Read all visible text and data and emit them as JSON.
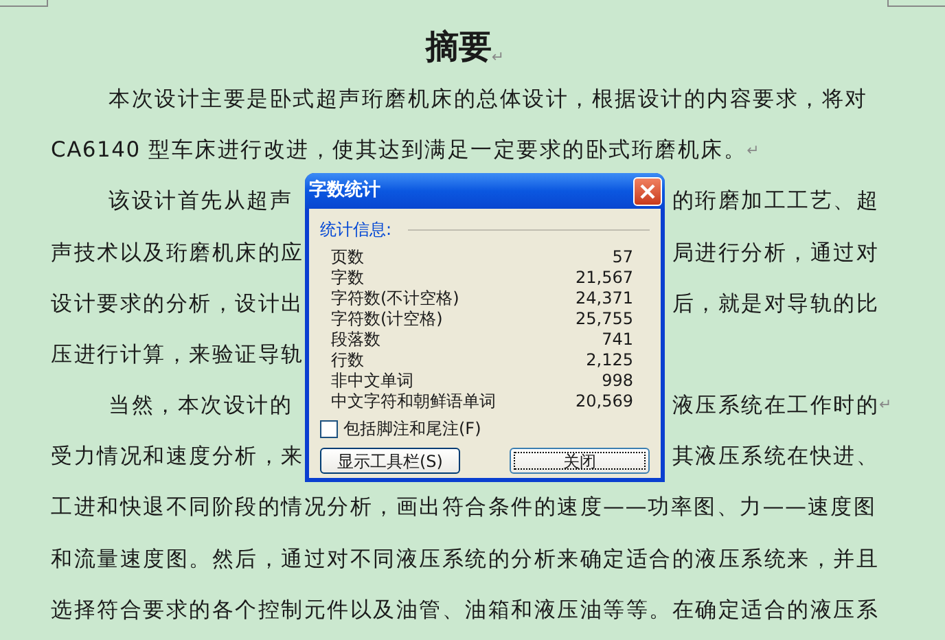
{
  "document": {
    "title": "摘要",
    "title_mark": "↵",
    "lines": [
      {
        "indent": true,
        "left": "本次设计主要是卧式超声珩磨机床的总体设计，根据设计的内容要求，将对"
      },
      {
        "indent": false,
        "left": "CA6140 型车床进行改进，使其达到满足一定要求的卧式珩磨机床。",
        "mark": "↵"
      },
      {
        "indent": true,
        "left": "该设计首先从超声",
        "right": "的珩磨加工工艺、超"
      },
      {
        "indent": false,
        "left": "声技术以及珩磨机床的应",
        "right": "局进行分析，通过对"
      },
      {
        "indent": false,
        "left": "设计要求的分析，设计出",
        "right": "后，就是对导轨的比"
      },
      {
        "indent": false,
        "left": "压进行计算，来验证导轨"
      },
      {
        "indent": true,
        "left": "当然，本次设计的",
        "right": "液压系统在工作时的",
        "mark": "↵"
      },
      {
        "indent": false,
        "left": "受力情况和速度分析，来",
        "right": "其液压系统在快进、"
      },
      {
        "indent": false,
        "left": "工进和快退不同阶段的情况分析，画出符合条件的速度——功率图、力——速度图"
      },
      {
        "indent": false,
        "left": "和流量速度图。然后，通过对不同液压系统的分析来确定适合的液压系统来，并且"
      },
      {
        "indent": false,
        "left": "选择符合要求的各个控制元件以及油管、油箱和液压油等等。在确定适合的液压系"
      }
    ]
  },
  "dialog": {
    "title": "字数统计",
    "group_label": "统计信息:",
    "stats": [
      {
        "label": "页数",
        "value": "57"
      },
      {
        "label": "字数",
        "value": "21,567"
      },
      {
        "label": "字符数(不计空格)",
        "value": "24,371"
      },
      {
        "label": "字符数(计空格)",
        "value": "25,755"
      },
      {
        "label": "段落数",
        "value": "741"
      },
      {
        "label": "行数",
        "value": "2,125"
      },
      {
        "label": "非中文单词",
        "value": "998"
      },
      {
        "label": "中文字符和朝鲜语单词",
        "value": "20,569"
      }
    ],
    "checkbox": {
      "label": "包括脚注和尾注(F)",
      "checked": false
    },
    "buttons": [
      {
        "label": "显示工具栏(S)",
        "default": false
      },
      {
        "label": "关闭",
        "default": true
      }
    ]
  }
}
